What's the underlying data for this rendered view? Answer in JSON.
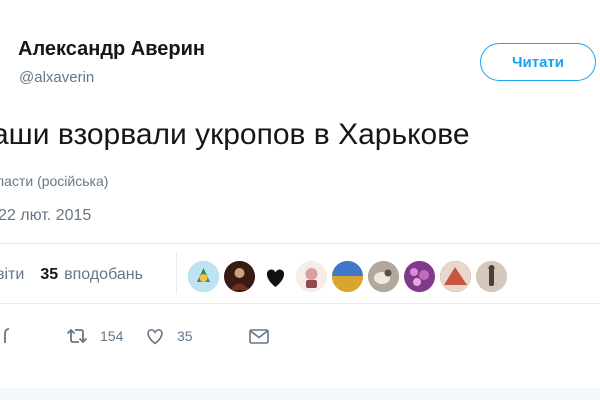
{
  "author": {
    "name": "Александр Аверин",
    "handle": "@alxaverin"
  },
  "follow_button": {
    "label": "Читати"
  },
  "tweet": {
    "text": "аши взорвали укропов в Харькове",
    "translate_link": "ласти (російська)",
    "date": "22 лют. 2015"
  },
  "stats": {
    "retweets_label": "віти",
    "likes_count": "35",
    "likes_label": "вподобань"
  },
  "avatars": [
    {
      "icon": "emblem-avatar",
      "color": "#5fa8d3"
    },
    {
      "icon": "dark-portrait-avatar",
      "color": "#5a2a22"
    },
    {
      "icon": "heart-avatar",
      "color": "#111111"
    },
    {
      "icon": "cartoon-avatar",
      "color": "#f2e4e2"
    },
    {
      "icon": "field-avatar",
      "color": "#d8a62e"
    },
    {
      "icon": "animal-avatar",
      "color": "#9a8e85"
    },
    {
      "icon": "flowers-avatar",
      "color": "#b457a8"
    },
    {
      "icon": "red-abstract-avatar",
      "color": "#c8553d"
    },
    {
      "icon": "figure-avatar",
      "color": "#b7a99b"
    }
  ],
  "actions": {
    "retweet_count": "154",
    "like_count": "35"
  },
  "colors": {
    "accent": "#1da1f2",
    "secondary_text": "#657786",
    "divider": "#e6ecf0"
  }
}
